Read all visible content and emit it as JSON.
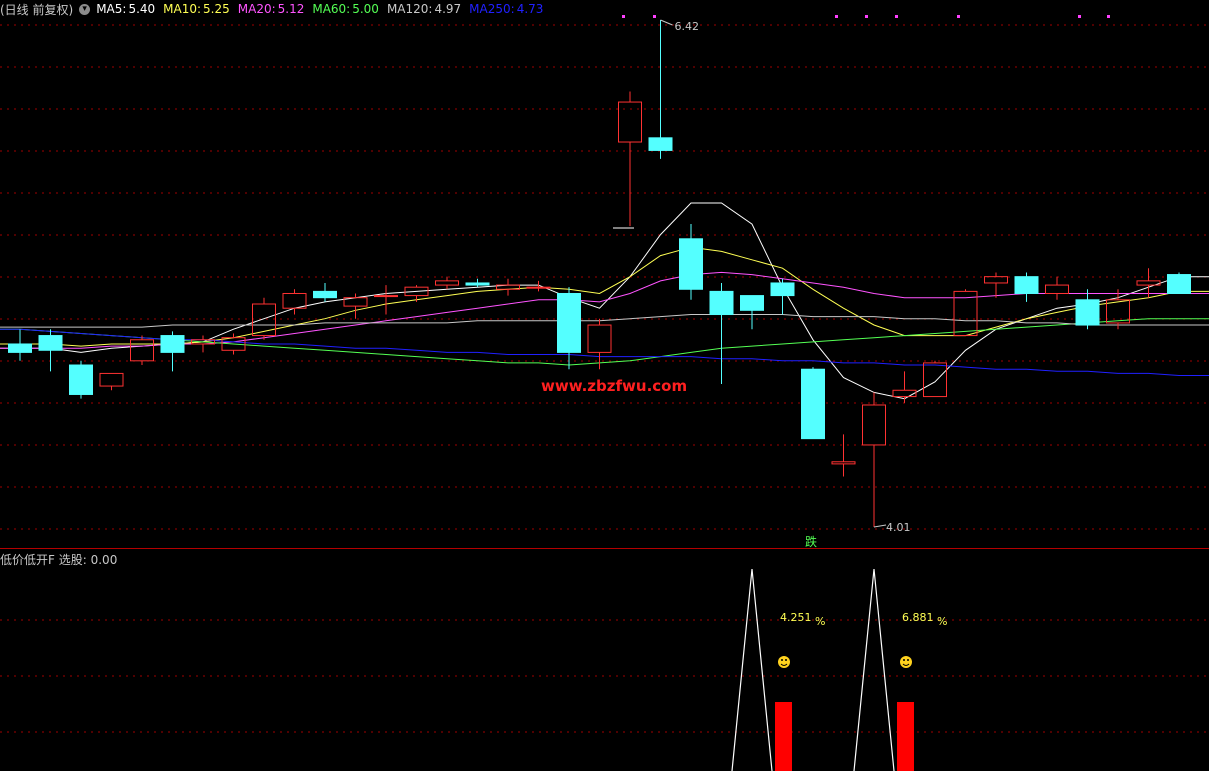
{
  "header": {
    "period_label": "(日线 前复权)",
    "ma_indicators": [
      {
        "name": "MA5:",
        "value": "5.40",
        "color": "#ffffff"
      },
      {
        "name": "MA10:",
        "value": "5.25",
        "color": "#ffff54"
      },
      {
        "name": "MA20:",
        "value": "5.12",
        "color": "#ff54ff"
      },
      {
        "name": "MA60:",
        "value": "5.00",
        "color": "#54ff54"
      },
      {
        "name": "MA120:",
        "value": "4.97",
        "color": "#c8c8c8"
      },
      {
        "name": "MA250:",
        "value": "4.73",
        "color": "#2020ff"
      }
    ]
  },
  "chart": {
    "high_label": "6.42",
    "low_label": "4.01",
    "signal_label": "跌",
    "watermark": "www.zbzfwu.com",
    "colors": {
      "up": "#ff3232",
      "down": "#54ffff",
      "grid": "#a00000",
      "background": "#000000"
    }
  },
  "indicator": {
    "name": "低价低开F",
    "pick_label": "选股:",
    "pick_value": "0.00",
    "signals": [
      {
        "percent": "4.251",
        "unit": "%"
      },
      {
        "percent": "6.881",
        "unit": "%"
      }
    ]
  },
  "chart_data": {
    "type": "candlestick",
    "price_range": [
      4.01,
      6.42
    ],
    "grid": true,
    "candles": [
      {
        "o": 4.88,
        "h": 4.95,
        "l": 4.8,
        "c": 4.84
      },
      {
        "o": 4.92,
        "h": 4.95,
        "l": 4.75,
        "c": 4.85
      },
      {
        "o": 4.78,
        "h": 4.8,
        "l": 4.62,
        "c": 4.64
      },
      {
        "o": 4.68,
        "h": 4.74,
        "l": 4.66,
        "c": 4.74
      },
      {
        "o": 4.8,
        "h": 4.92,
        "l": 4.78,
        "c": 4.9
      },
      {
        "o": 4.92,
        "h": 4.94,
        "l": 4.75,
        "c": 4.84
      },
      {
        "o": 4.88,
        "h": 4.92,
        "l": 4.84,
        "c": 4.9
      },
      {
        "o": 4.85,
        "h": 4.93,
        "l": 4.83,
        "c": 4.91
      },
      {
        "o": 4.92,
        "h": 5.1,
        "l": 4.9,
        "c": 5.07
      },
      {
        "o": 5.05,
        "h": 5.14,
        "l": 5.02,
        "c": 5.12
      },
      {
        "o": 5.13,
        "h": 5.17,
        "l": 5.08,
        "c": 5.1
      },
      {
        "o": 5.06,
        "h": 5.12,
        "l": 5.0,
        "c": 5.1
      },
      {
        "o": 5.11,
        "h": 5.16,
        "l": 5.02,
        "c": 5.11
      },
      {
        "o": 5.11,
        "h": 5.16,
        "l": 5.08,
        "c": 5.15
      },
      {
        "o": 5.16,
        "h": 5.2,
        "l": 5.14,
        "c": 5.18
      },
      {
        "o": 5.17,
        "h": 5.19,
        "l": 5.15,
        "c": 5.16
      },
      {
        "o": 5.14,
        "h": 5.19,
        "l": 5.11,
        "c": 5.16
      },
      {
        "o": 5.15,
        "h": 5.18,
        "l": 5.13,
        "c": 5.15
      },
      {
        "o": 5.12,
        "h": 5.15,
        "l": 4.76,
        "c": 4.84
      },
      {
        "o": 4.84,
        "h": 5.0,
        "l": 4.76,
        "c": 4.97
      },
      {
        "o": 5.84,
        "h": 6.08,
        "l": 5.44,
        "c": 6.03
      },
      {
        "o": 5.86,
        "h": 6.42,
        "l": 5.76,
        "c": 5.8
      },
      {
        "o": 5.38,
        "h": 5.45,
        "l": 5.09,
        "c": 5.14
      },
      {
        "o": 5.13,
        "h": 5.17,
        "l": 4.69,
        "c": 5.02
      },
      {
        "o": 5.11,
        "h": 5.1,
        "l": 4.95,
        "c": 5.04
      },
      {
        "o": 5.17,
        "h": 5.19,
        "l": 5.02,
        "c": 5.11
      },
      {
        "o": 4.76,
        "h": 4.77,
        "l": 4.43,
        "c": 4.43
      },
      {
        "o": 4.31,
        "h": 4.45,
        "l": 4.25,
        "c": 4.32
      },
      {
        "o": 4.4,
        "h": 4.65,
        "l": 4.01,
        "c": 4.59
      },
      {
        "o": 4.63,
        "h": 4.75,
        "l": 4.6,
        "c": 4.66
      },
      {
        "o": 4.63,
        "h": 4.8,
        "l": 4.63,
        "c": 4.79
      },
      {
        "o": 4.92,
        "h": 5.14,
        "l": 4.92,
        "c": 5.13
      },
      {
        "o": 5.17,
        "h": 5.22,
        "l": 5.1,
        "c": 5.2
      },
      {
        "o": 5.2,
        "h": 5.22,
        "l": 5.08,
        "c": 5.12
      },
      {
        "o": 5.12,
        "h": 5.2,
        "l": 5.09,
        "c": 5.16
      },
      {
        "o": 5.09,
        "h": 5.14,
        "l": 4.95,
        "c": 4.97
      },
      {
        "o": 4.98,
        "h": 5.14,
        "l": 4.95,
        "c": 5.09
      },
      {
        "o": 5.16,
        "h": 5.24,
        "l": 5.1,
        "c": 5.18
      },
      {
        "o": 5.21,
        "h": 5.22,
        "l": 5.12,
        "c": 5.12
      }
    ],
    "ma_lines": {
      "MA5": [
        4.86,
        4.86,
        4.84,
        4.86,
        4.87,
        4.88,
        4.89,
        4.95,
        5.0,
        5.05,
        5.08,
        5.1,
        5.12,
        5.13,
        5.14,
        5.15,
        5.16,
        5.16,
        5.1,
        5.05,
        5.2,
        5.4,
        5.55,
        5.55,
        5.45,
        5.15,
        4.9,
        4.72,
        4.65,
        4.62,
        4.7,
        4.85,
        4.95,
        5.0,
        5.05,
        5.07,
        5.1,
        5.15,
        5.2
      ],
      "MA10": [
        4.88,
        4.88,
        4.87,
        4.88,
        4.88,
        4.88,
        4.89,
        4.91,
        4.94,
        4.97,
        5.0,
        5.04,
        5.07,
        5.09,
        5.11,
        5.13,
        5.14,
        5.15,
        5.14,
        5.12,
        5.2,
        5.3,
        5.34,
        5.32,
        5.28,
        5.24,
        5.14,
        5.05,
        4.97,
        4.92,
        4.92,
        4.92,
        4.96,
        5.0,
        5.03,
        5.06,
        5.08,
        5.1,
        5.13
      ],
      "MA20": [
        4.86,
        4.86,
        4.86,
        4.87,
        4.87,
        4.88,
        4.88,
        4.89,
        4.91,
        4.93,
        4.95,
        4.97,
        4.99,
        5.01,
        5.03,
        5.05,
        5.07,
        5.09,
        5.09,
        5.08,
        5.12,
        5.18,
        5.21,
        5.22,
        5.21,
        5.19,
        5.17,
        5.15,
        5.12,
        5.1,
        5.1,
        5.1,
        5.11,
        5.12,
        5.12,
        5.12,
        5.12,
        5.12,
        5.12
      ],
      "MA60": [
        4.95,
        4.94,
        4.93,
        4.92,
        4.91,
        4.9,
        4.89,
        4.88,
        4.87,
        4.86,
        4.85,
        4.84,
        4.83,
        4.82,
        4.81,
        4.8,
        4.79,
        4.79,
        4.78,
        4.79,
        4.8,
        4.82,
        4.84,
        4.86,
        4.87,
        4.88,
        4.89,
        4.9,
        4.91,
        4.92,
        4.93,
        4.94,
        4.95,
        4.96,
        4.97,
        4.98,
        4.99,
        5.0,
        5.0
      ],
      "MA120": [
        4.96,
        4.96,
        4.96,
        4.96,
        4.96,
        4.97,
        4.97,
        4.97,
        4.97,
        4.97,
        4.98,
        4.98,
        4.98,
        4.98,
        4.98,
        4.99,
        4.99,
        4.99,
        4.99,
        4.99,
        5.0,
        5.01,
        5.02,
        5.02,
        5.02,
        5.02,
        5.01,
        5.01,
        5.01,
        5.0,
        5.0,
        4.99,
        4.99,
        4.98,
        4.98,
        4.97,
        4.97,
        4.97,
        4.97
      ],
      "MA250": [
        4.95,
        4.94,
        4.93,
        4.92,
        4.91,
        4.9,
        4.9,
        4.89,
        4.88,
        4.88,
        4.87,
        4.86,
        4.86,
        4.85,
        4.84,
        4.84,
        4.83,
        4.83,
        4.83,
        4.82,
        4.82,
        4.82,
        4.82,
        4.81,
        4.81,
        4.8,
        4.8,
        4.79,
        4.79,
        4.78,
        4.78,
        4.77,
        4.76,
        4.76,
        4.75,
        4.75,
        4.74,
        4.74,
        4.73
      ]
    },
    "indicator_signals": [
      {
        "candle_index": 24,
        "percent": 4.251
      },
      {
        "candle_index": 28,
        "percent": 6.881
      }
    ]
  }
}
